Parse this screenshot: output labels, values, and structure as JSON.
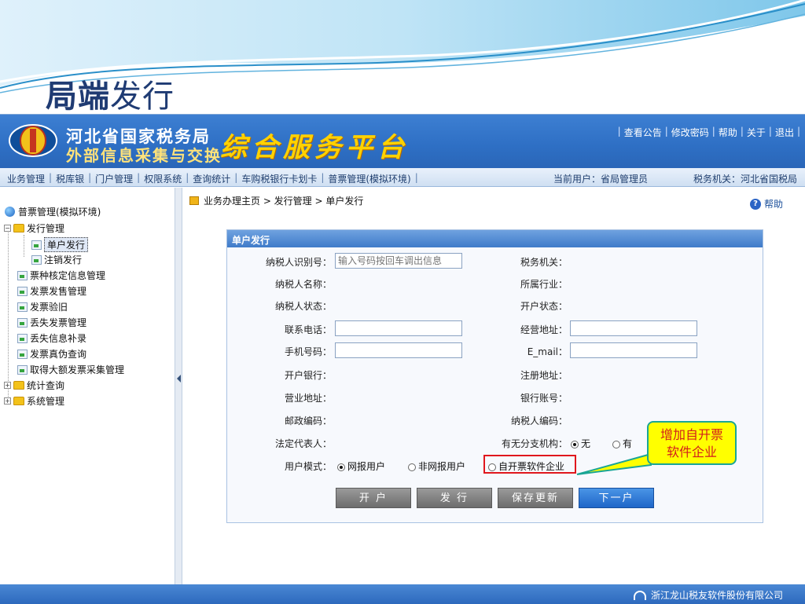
{
  "slide": {
    "title_bold": "局端",
    "title_rest": "发行"
  },
  "header": {
    "org_line1": "河北省国家税务局",
    "org_line2": "外部信息采集与交换",
    "platform": "综合服务平台",
    "links": [
      "查看公告",
      "修改密码",
      "帮助",
      "关于",
      "退出"
    ]
  },
  "menu": {
    "items": [
      "业务管理",
      "税库银",
      "门户管理",
      "权限系统",
      "查询统计",
      "车购税银行卡划卡",
      "普票管理(模拟环境)"
    ],
    "current_user": "当前用户：省局管理员",
    "tax_office": "税务机关：河北省国税局"
  },
  "sidebar": {
    "root": "普票管理(模拟环境)",
    "group1": "发行管理",
    "group1_items": [
      "单户发行",
      "注销发行"
    ],
    "items": [
      "票种核定信息管理",
      "发票发售管理",
      "发票验旧",
      "丢失发票管理",
      "丢失信息补录",
      "发票真伪查询",
      "取得大额发票采集管理"
    ],
    "group2": "统计查询",
    "group3": "系统管理"
  },
  "content": {
    "breadcrumb": "业务办理主页 > 发行管理 > 单户发行",
    "help": "帮助",
    "panel_title": "单户发行",
    "labels": {
      "taxpayer_id": "纳税人识别号：",
      "tax_office": "税务机关：",
      "taxpayer_name": "纳税人名称：",
      "industry": "所属行业：",
      "taxpayer_status": "纳税人状态：",
      "open_status": "开户状态：",
      "phone": "联系电话：",
      "biz_address": "经营地址：",
      "mobile": "手机号码：",
      "email": "E_mail：",
      "bank": "开户银行：",
      "reg_address": "注册地址：",
      "business_address": "营业地址：",
      "bank_account": "银行账号：",
      "postcode": "邮政编码：",
      "taxpayer_code": "纳税人编码：",
      "legal_rep": "法定代表人：",
      "branch": "有无分支机构：",
      "user_mode": "用户模式："
    },
    "taxpayer_id_placeholder": "输入号码按回车调出信息",
    "branch_options": [
      "无",
      "有"
    ],
    "user_mode_options": [
      "网报用户",
      "非网报用户",
      "自开票软件企业"
    ],
    "buttons": [
      "开 户",
      "发 行",
      "保存更新",
      "下一户"
    ]
  },
  "callout": {
    "line1": "增加自开票",
    "line2": "软件企业"
  },
  "footer": {
    "company": "浙江龙山税友软件股份有限公司"
  },
  "colors": {
    "banner": "#2e6fc4",
    "highlight": "#e0171d",
    "callout_bg": "#ffff00",
    "callout_text": "#d21c1c"
  }
}
